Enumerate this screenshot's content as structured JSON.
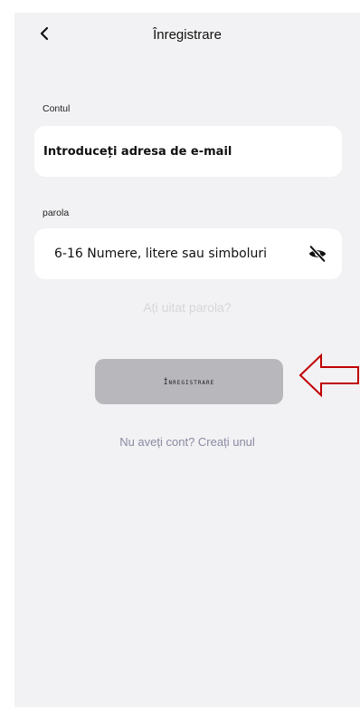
{
  "header": {
    "title": "Înregistrare"
  },
  "account": {
    "label": "Contul",
    "placeholder": "Introduceți adresa de e-mail"
  },
  "password": {
    "label": "parola",
    "placeholder": "6-16 Numere, litere sau simboluri"
  },
  "forgot_link": "Ați uitat parola?",
  "submit_label": "Înregistrare",
  "signup_link": "Nu aveți cont? Creați unul",
  "icons": {
    "back": "chevron-left-icon",
    "toggle_password": "eye-slash-icon",
    "annotation": "arrow-left-annotation"
  },
  "colors": {
    "background": "#f2f2f4",
    "field": "#ffffff",
    "button": "#b7b7bc",
    "muted_link": "#d6d6da",
    "link": "#8a8aa2",
    "annotation": "#c00000"
  }
}
